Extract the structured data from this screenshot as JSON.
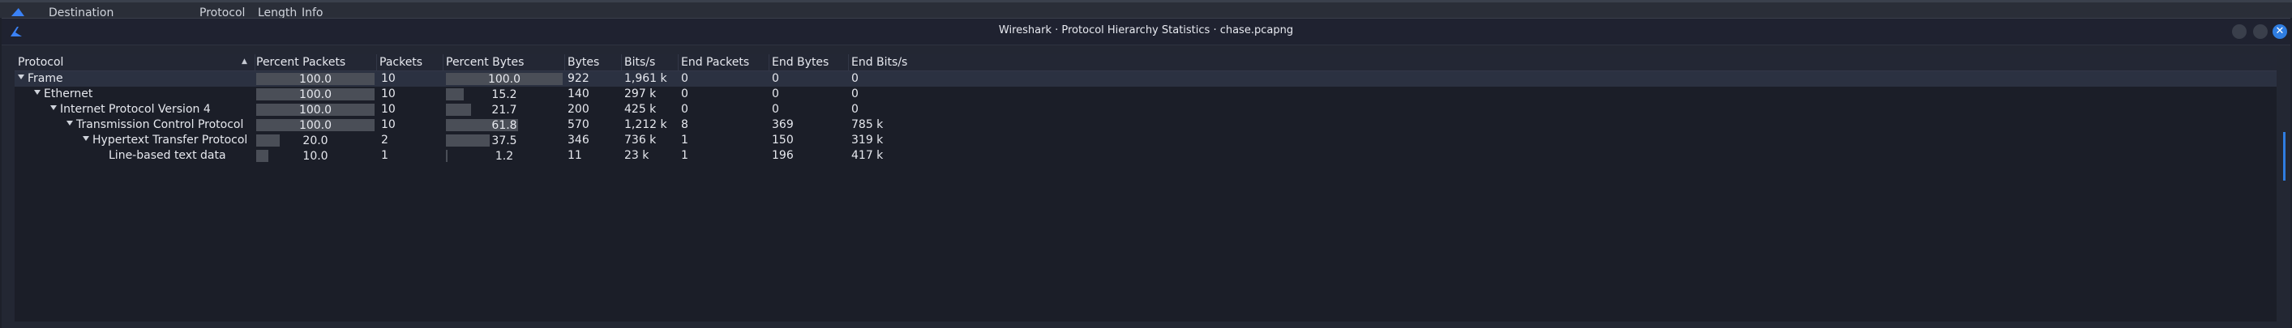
{
  "background_window": {
    "columns": [
      "Destination",
      "Protocol",
      "Length",
      "Info"
    ]
  },
  "dialog": {
    "title": "Wireshark · Protocol Hierarchy Statistics · chase.pcapng",
    "buttons": {
      "minimize": "",
      "maximize": "",
      "close": "✕"
    }
  },
  "table": {
    "headers": {
      "protocol": "Protocol",
      "percent_packets": "Percent Packets",
      "packets": "Packets",
      "percent_bytes": "Percent Bytes",
      "bytes": "Bytes",
      "bits_s": "Bits/s",
      "end_packets": "End Packets",
      "end_bytes": "End Bytes",
      "end_bits_s": "End Bits/s"
    },
    "rows": [
      {
        "protocol": "Frame",
        "depth": 0,
        "expanded": true,
        "percent_packets": "100.0",
        "packets": "10",
        "percent_bytes": "100.0",
        "bytes": "922",
        "bits_s": "1,961 k",
        "end_packets": "0",
        "end_bytes": "0",
        "end_bits_s": "0",
        "pp_frac": 1.0,
        "pb_frac": 1.0
      },
      {
        "protocol": "Ethernet",
        "depth": 1,
        "expanded": true,
        "percent_packets": "100.0",
        "packets": "10",
        "percent_bytes": "15.2",
        "bytes": "140",
        "bits_s": "297 k",
        "end_packets": "0",
        "end_bytes": "0",
        "end_bits_s": "0",
        "pp_frac": 1.0,
        "pb_frac": 0.152
      },
      {
        "protocol": "Internet Protocol Version 4",
        "depth": 2,
        "expanded": true,
        "percent_packets": "100.0",
        "packets": "10",
        "percent_bytes": "21.7",
        "bytes": "200",
        "bits_s": "425 k",
        "end_packets": "0",
        "end_bytes": "0",
        "end_bits_s": "0",
        "pp_frac": 1.0,
        "pb_frac": 0.217
      },
      {
        "protocol": "Transmission Control Protocol",
        "depth": 3,
        "expanded": true,
        "percent_packets": "100.0",
        "packets": "10",
        "percent_bytes": "61.8",
        "bytes": "570",
        "bits_s": "1,212 k",
        "end_packets": "8",
        "end_bytes": "369",
        "end_bits_s": "785 k",
        "pp_frac": 1.0,
        "pb_frac": 0.618
      },
      {
        "protocol": "Hypertext Transfer Protocol",
        "depth": 4,
        "expanded": true,
        "percent_packets": "20.0",
        "packets": "2",
        "percent_bytes": "37.5",
        "bytes": "346",
        "bits_s": "736 k",
        "end_packets": "1",
        "end_bytes": "150",
        "end_bits_s": "319 k",
        "pp_frac": 0.2,
        "pb_frac": 0.375
      },
      {
        "protocol": "Line-based text data",
        "depth": 5,
        "expanded": false,
        "percent_packets": "10.0",
        "packets": "1",
        "percent_bytes": "1.2",
        "bytes": "11",
        "bits_s": "23 k",
        "end_packets": "1",
        "end_bytes": "196",
        "end_bits_s": "417 k",
        "pp_frac": 0.1,
        "pb_frac": 0.012
      }
    ]
  }
}
